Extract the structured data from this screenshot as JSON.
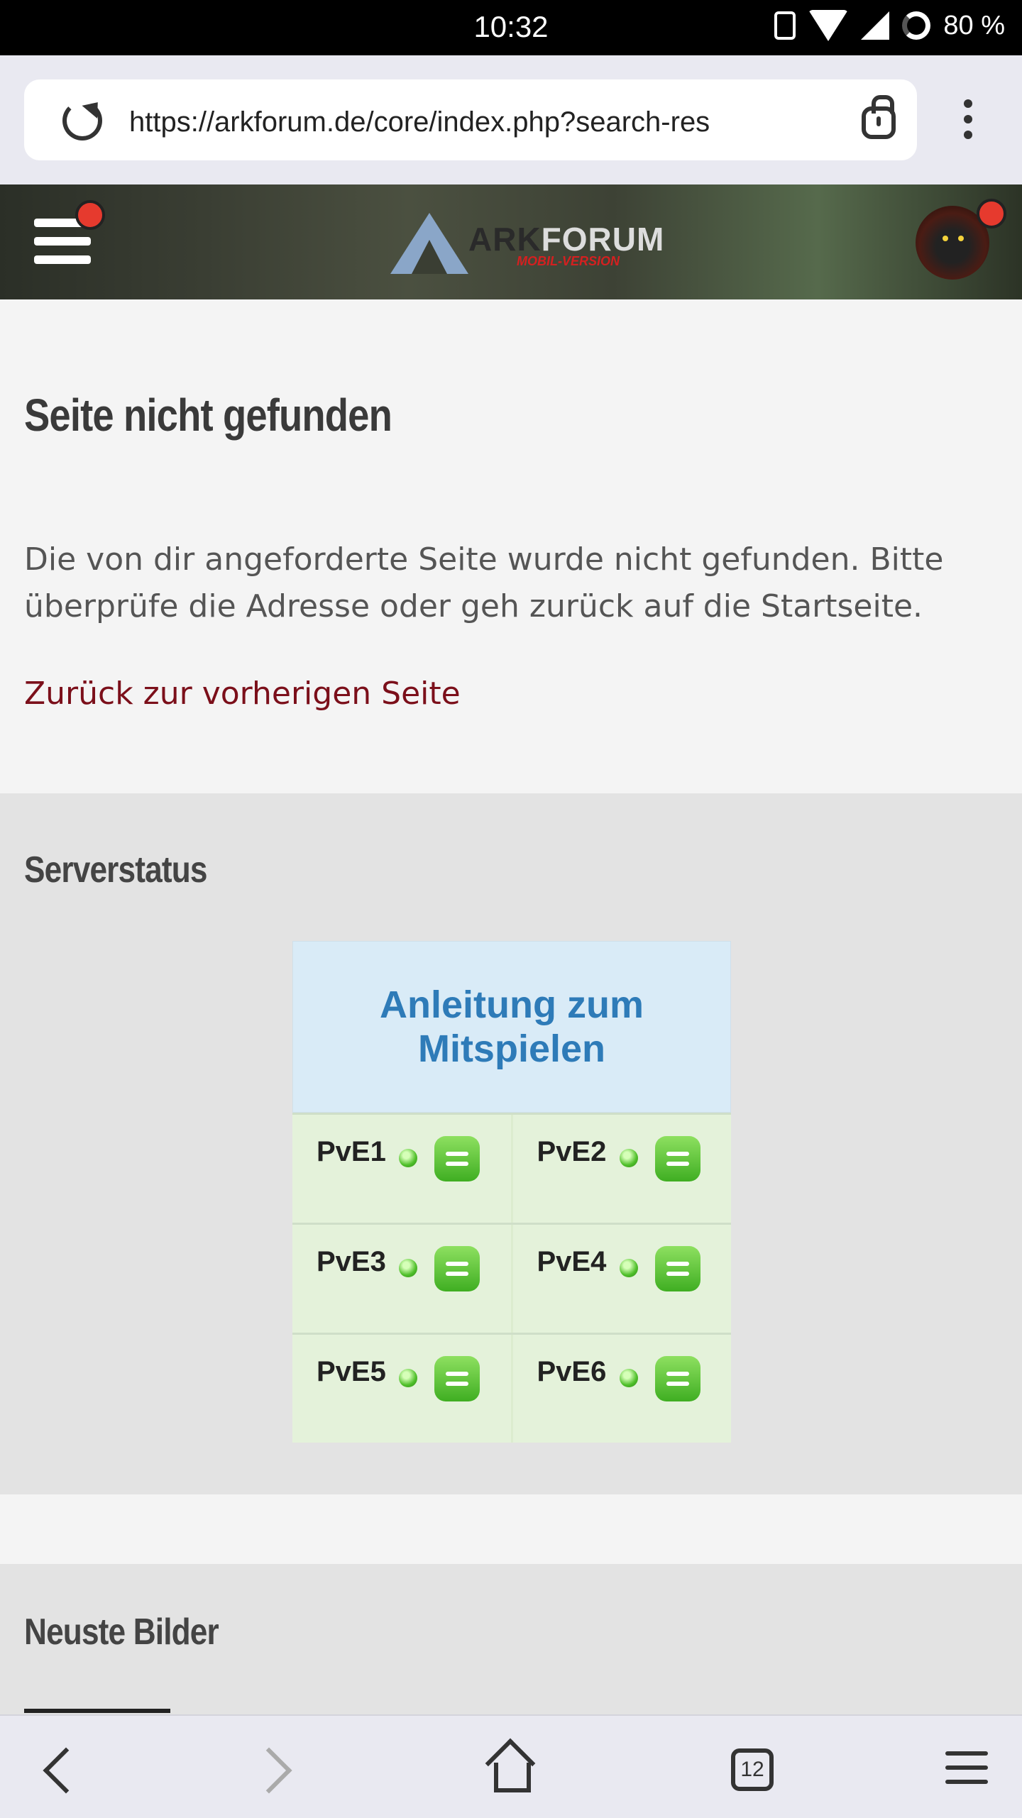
{
  "status_bar": {
    "time": "10:32",
    "battery": "80 %"
  },
  "browser": {
    "url": "https://arkforum.de/core/index.php?search-res",
    "tab_count": "12"
  },
  "header": {
    "logo_text_dark": "ARK",
    "logo_text_light": "FORUM",
    "logo_subtitle": "MOBIL-VERSION"
  },
  "main": {
    "title": "Seite nicht gefunden",
    "description": "Die von dir angeforderte Seite wurde nicht gefunden. Bitte überprüfe die Adresse oder geh zurück auf die Startseite.",
    "back_link": "Zurück zur vorherigen Seite"
  },
  "serverstatus": {
    "title": "Serverstatus",
    "guide_link": "Anleitung zum Mitspielen",
    "servers": [
      "PvE1",
      "PvE2",
      "PvE3",
      "PvE4",
      "PvE5",
      "PvE6"
    ]
  },
  "images_section": {
    "title": "Neuste Bilder"
  }
}
